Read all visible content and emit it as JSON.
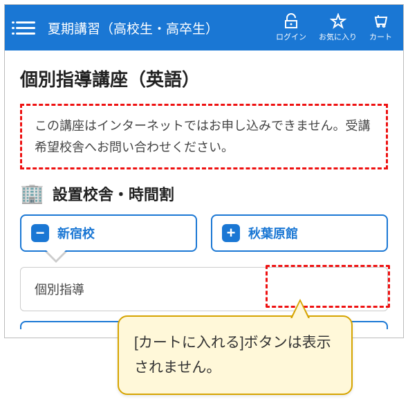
{
  "header": {
    "title": "夏期講習（高校生・高卒生）",
    "icons": {
      "login": "ログイン",
      "favorite": "お気に入り",
      "cart": "カート"
    }
  },
  "page": {
    "title": "個別指導講座（英語）",
    "notice": "この講座はインターネットではお申し込みできません。受講希望校舎へお問い合わせください。",
    "section_title": "設置校舎・時間割"
  },
  "tabs": [
    {
      "label": "新宿校",
      "symbol": "−",
      "active": true
    },
    {
      "label": "秋葉原館",
      "symbol": "+",
      "active": false
    }
  ],
  "detail": {
    "label": "個別指導"
  },
  "callout": "[カートに入れる]ボタンは表示されません。"
}
